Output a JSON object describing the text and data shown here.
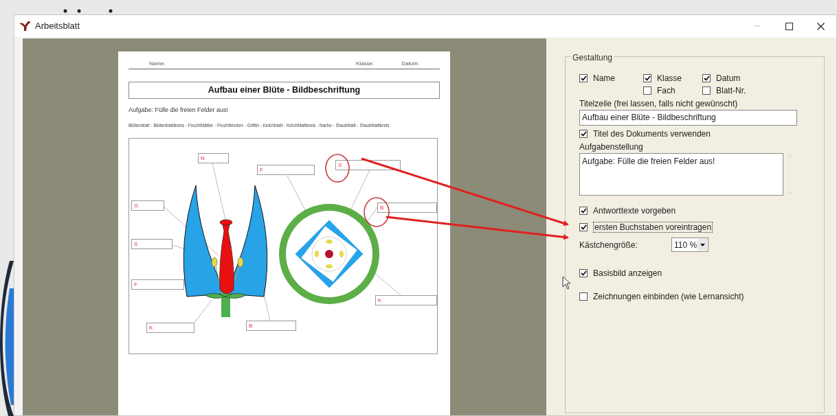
{
  "window": {
    "title": "Arbeitsblatt"
  },
  "worksheet": {
    "header_fields": [
      "Name:",
      "Klasse:",
      "Datum:"
    ],
    "title": "Aufbau einer Blüte - Bildbeschriftung",
    "task": "Aufgabe: Fülle die freien Felder aus!",
    "word_bank": "Blütenblatt - Blütenblattkreis - Fruchtblätter - Fruchtknoten - Griffel - Kelchblatt - Kelchblattkreis - Narbe - Staubblatt - Staubblattkreis",
    "diagram": {
      "labels": [
        {
          "letter": "N"
        },
        {
          "letter": "F"
        },
        {
          "letter": "S"
        },
        {
          "letter": "G"
        },
        {
          "letter": "B"
        },
        {
          "letter": "S"
        },
        {
          "letter": "F"
        },
        {
          "letter": "K"
        },
        {
          "letter": "K"
        },
        {
          "letter": "B"
        }
      ]
    }
  },
  "settings": {
    "group_title": "Gestaltung",
    "header_columns": [
      {
        "items": [
          {
            "label": "Name",
            "checked": true
          }
        ]
      },
      {
        "items": [
          {
            "label": "Klasse",
            "checked": true
          },
          {
            "label": "Fach",
            "checked": false
          }
        ]
      },
      {
        "items": [
          {
            "label": "Datum",
            "checked": true
          },
          {
            "label": "Blatt-Nr.",
            "checked": false
          }
        ]
      }
    ],
    "controls": [
      {
        "kind": "caption",
        "label": "Titelzeile (frei lassen, falls nicht gewünscht)"
      },
      {
        "kind": "text_field",
        "value": "Aufbau einer Blüte - Bildbeschriftung"
      },
      {
        "kind": "checkbox",
        "label": "Titel des Dokuments verwenden",
        "checked": true,
        "focused": false
      },
      {
        "kind": "caption",
        "label": "Aufgabenstellung"
      },
      {
        "kind": "text_area",
        "value": "Aufgabe: Fülle die freien Felder aus!"
      },
      {
        "kind": "checkbox",
        "label": "Antworttexte vorgeben",
        "checked": true,
        "focused": false
      },
      {
        "kind": "checkbox",
        "label": "ersten Buchstaben voreintragen",
        "checked": true,
        "focused": true
      },
      {
        "kind": "select",
        "label": "Kästchengröße:",
        "value": "110 %"
      },
      {
        "kind": "checkbox",
        "label": "Basisbild anzeigen",
        "checked": true,
        "focused": false
      },
      {
        "kind": "checkbox",
        "label": "Zeichnungen einbinden (wie Lernansicht)",
        "checked": false,
        "focused": false
      }
    ]
  }
}
